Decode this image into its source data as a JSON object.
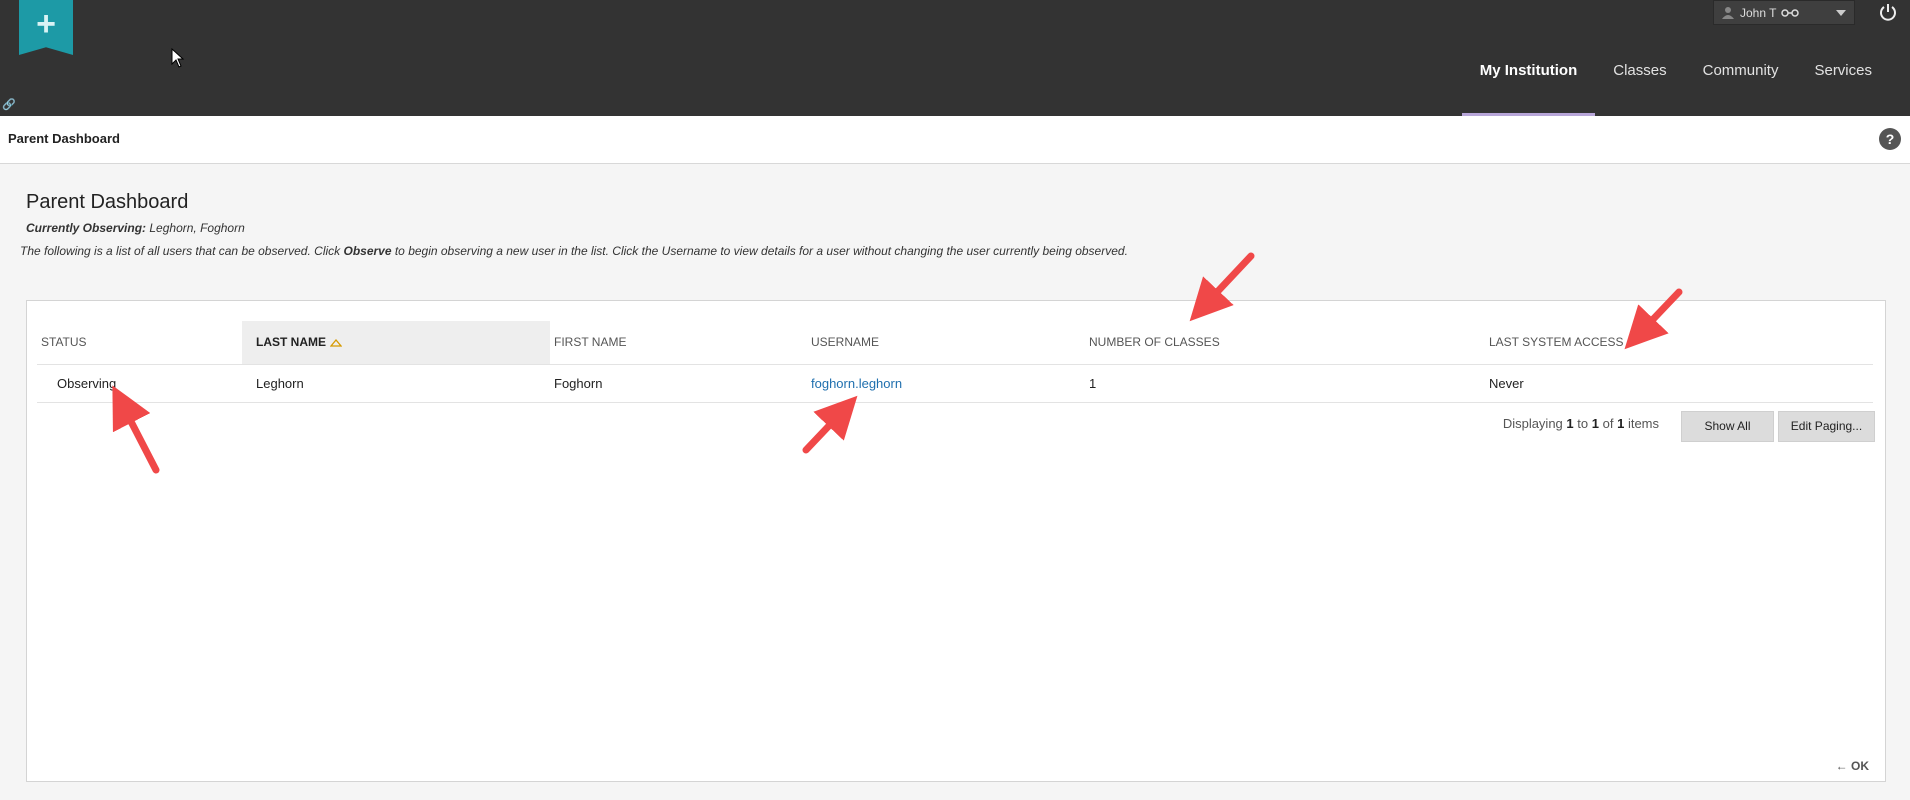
{
  "header": {
    "logo_icon": "plus-icon",
    "user": {
      "name": "John T",
      "icon": "person-icon",
      "badge_icon": "glasses-icon"
    },
    "power_icon": "power-icon",
    "nav": [
      {
        "label": "My Institution",
        "active": true
      },
      {
        "label": "Classes",
        "active": false
      },
      {
        "label": "Community",
        "active": false
      },
      {
        "label": "Services",
        "active": false
      }
    ]
  },
  "breadcrumb": {
    "label": "Parent Dashboard",
    "help_icon": "?"
  },
  "page": {
    "title": "Parent Dashboard",
    "observing_label": "Currently Observing:",
    "observing_value": "Leghorn, Foghorn",
    "instructions_part1": "The following is a list of all users that can be observed. Click ",
    "instructions_bold": "Observe",
    "instructions_part2": " to begin observing a new user in the list. Click the Username to view details for a user without changing the user currently being observed."
  },
  "table": {
    "columns": [
      "STATUS",
      "LAST NAME",
      "FIRST NAME",
      "USERNAME",
      "NUMBER OF CLASSES",
      "LAST SYSTEM ACCESS"
    ],
    "sorted_column": "LAST NAME",
    "rows": [
      {
        "status": "Observing",
        "last_name": "Leghorn",
        "first_name": "Foghorn",
        "username": "foghorn.leghorn",
        "classes": "1",
        "last_access": "Never"
      }
    ]
  },
  "paging": {
    "displaying": "Displaying",
    "from": "1",
    "to_word": "to",
    "to": "1",
    "of_word": "of",
    "total": "1",
    "items_word": "items",
    "show_all": "Show All",
    "edit_paging": "Edit Paging..."
  },
  "footer": {
    "ok": "← OK"
  },
  "colors": {
    "header_bg": "#333333",
    "logo": "#1d9aa6",
    "link": "#1f6fae",
    "annotation": "#f04848",
    "active_tab_underline": "#b8a6d9"
  }
}
